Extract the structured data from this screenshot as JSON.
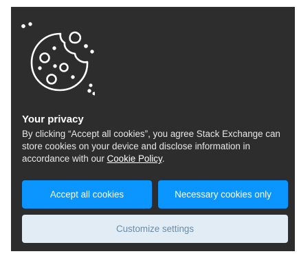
{
  "dialog": {
    "icon": "cookie-icon",
    "title": "Your privacy",
    "body_before_link": "By clicking “Accept all cookies”, you agree Stack Exchange can store cookies on your device and disclose information in accordance with our ",
    "policy_link": "Cookie Policy",
    "body_after_link": "."
  },
  "buttons": {
    "accept_all": "Accept all cookies",
    "necessary_only": "Necessary cookies only",
    "customize": "Customize settings"
  },
  "colors": {
    "dialog_background": "#2d2d2d",
    "primary_button": "#0a95ff",
    "secondary_button": "#e1ecf4",
    "secondary_button_text": "#6b8ca8"
  }
}
